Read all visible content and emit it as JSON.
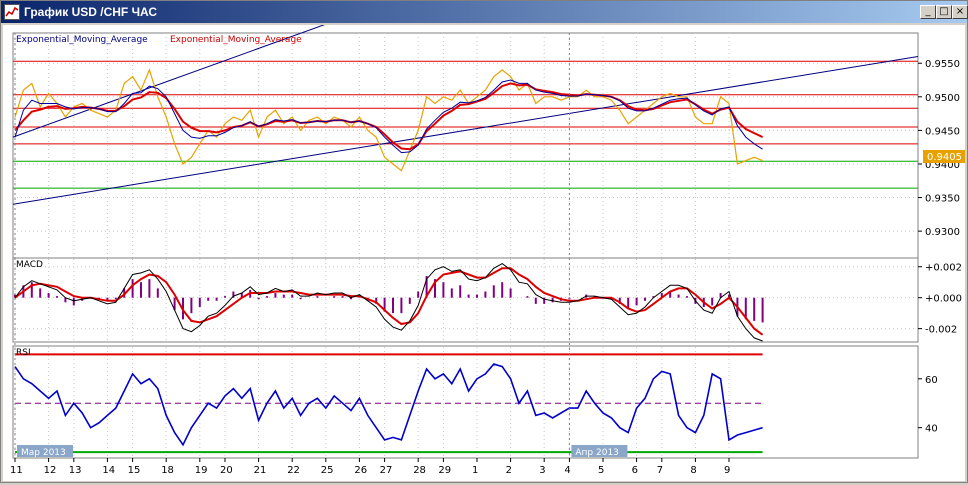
{
  "window": {
    "title": "График USD /CHF ЧАС",
    "buttons": {
      "minimize": "_",
      "maximize": "□",
      "close": "×"
    }
  },
  "chart_data": [
    {
      "type": "line",
      "name": "price",
      "legend": [
        "Exponential_Moving_Average",
        "Exponential_Moving_Average"
      ],
      "ylim": [
        0.926,
        0.9595
      ],
      "yticks": [
        "0.9550",
        "0.9500",
        "0.9450",
        "0.9400",
        "0.9350",
        "0.9300"
      ],
      "current_price": "0.9405",
      "series": [
        {
          "name": "price",
          "color": "#e8a200",
          "values": [
            0.947,
            0.951,
            0.952,
            0.9485,
            0.9505,
            0.949,
            0.947,
            0.9485,
            0.949,
            0.948,
            0.9475,
            0.947,
            0.948,
            0.952,
            0.953,
            0.951,
            0.954,
            0.95,
            0.947,
            0.943,
            0.94,
            0.941,
            0.943,
            0.945,
            0.944,
            0.946,
            0.947,
            0.9465,
            0.948,
            0.944,
            0.947,
            0.948,
            0.946,
            0.947,
            0.945,
            0.9465,
            0.947,
            0.946,
            0.947,
            0.9465,
            0.9455,
            0.947,
            0.945,
            0.944,
            0.941,
            0.94,
            0.939,
            0.942,
            0.945,
            0.95,
            0.949,
            0.95,
            0.9495,
            0.951,
            0.949,
            0.95,
            0.951,
            0.953,
            0.954,
            0.953,
            0.951,
            0.952,
            0.949,
            0.95,
            0.95,
            0.9495,
            0.95,
            0.95,
            0.951,
            0.95,
            0.95,
            0.9495,
            0.948,
            0.946,
            0.947,
            0.948,
            0.949,
            0.95,
            0.9505,
            0.95,
            0.95,
            0.947,
            0.946,
            0.946,
            0.95,
            0.949,
            0.94,
            0.9405,
            0.941,
            0.9405
          ]
        },
        {
          "name": "ema_fast",
          "color": "#0000a0",
          "values": [
            0.944,
            0.948,
            0.9495,
            0.949,
            0.949,
            0.949,
            0.9485,
            0.9482,
            0.9484,
            0.9484,
            0.9482,
            0.9478,
            0.9478,
            0.949,
            0.9505,
            0.9506,
            0.9516,
            0.9512,
            0.95,
            0.9475,
            0.945,
            0.944,
            0.9438,
            0.9442,
            0.9442,
            0.9447,
            0.9454,
            0.9457,
            0.9463,
            0.9456,
            0.946,
            0.9466,
            0.9464,
            0.9466,
            0.9461,
            0.9462,
            0.9464,
            0.9463,
            0.9465,
            0.9465,
            0.9462,
            0.9464,
            0.946,
            0.9454,
            0.944,
            0.9428,
            0.9417,
            0.9418,
            0.9428,
            0.9452,
            0.9465,
            0.9477,
            0.9483,
            0.9492,
            0.9491,
            0.9494,
            0.9499,
            0.951,
            0.9522,
            0.9525,
            0.952,
            0.952,
            0.951,
            0.9507,
            0.9505,
            0.9502,
            0.9501,
            0.9501,
            0.9504,
            0.9503,
            0.9502,
            0.95,
            0.9494,
            0.9483,
            0.9479,
            0.9479,
            0.9483,
            0.9489,
            0.9495,
            0.9497,
            0.9498,
            0.9488,
            0.9479,
            0.9473,
            0.9482,
            0.9485,
            0.9457,
            0.944,
            0.943,
            0.9422
          ]
        },
        {
          "name": "ema_slow",
          "color": "#dd0000",
          "values": [
            0.945,
            0.9465,
            0.9478,
            0.9481,
            0.9485,
            0.9486,
            0.9482,
            0.9483,
            0.9485,
            0.9484,
            0.9482,
            0.9479,
            0.9479,
            0.9486,
            0.9496,
            0.9499,
            0.9507,
            0.9506,
            0.9498,
            0.9482,
            0.9463,
            0.9454,
            0.9449,
            0.9449,
            0.9447,
            0.945,
            0.9455,
            0.9457,
            0.9462,
            0.9456,
            0.9459,
            0.9464,
            0.9463,
            0.9465,
            0.9461,
            0.9462,
            0.9464,
            0.9463,
            0.9465,
            0.9465,
            0.9462,
            0.9464,
            0.946,
            0.9455,
            0.9444,
            0.9432,
            0.9423,
            0.9422,
            0.9429,
            0.9449,
            0.946,
            0.9472,
            0.9479,
            0.9488,
            0.9489,
            0.9493,
            0.9497,
            0.9506,
            0.9516,
            0.952,
            0.9517,
            0.9518,
            0.9511,
            0.9509,
            0.9507,
            0.9504,
            0.9503,
            0.9502,
            0.9504,
            0.9503,
            0.9502,
            0.95,
            0.9495,
            0.9486,
            0.9481,
            0.948,
            0.9482,
            0.9487,
            0.9492,
            0.9494,
            0.9496,
            0.9489,
            0.9481,
            0.9475,
            0.9481,
            0.9484,
            0.9463,
            0.9452,
            0.9446,
            0.944
          ]
        }
      ],
      "hlines": [
        {
          "value": 0.9553,
          "color": "#dd0000"
        },
        {
          "value": 0.9503,
          "color": "#dd0000"
        },
        {
          "value": 0.9483,
          "color": "#dd0000"
        },
        {
          "value": 0.9455,
          "color": "#dd0000"
        },
        {
          "value": 0.943,
          "color": "#dd0000"
        },
        {
          "value": 0.9404,
          "color": "#00aa00"
        },
        {
          "value": 0.9364,
          "color": "#00aa00"
        }
      ],
      "trendlines": [
        {
          "from": [
            0,
            0.934
          ],
          "to": [
            1,
            0.956
          ],
          "color": "#000080"
        },
        {
          "from": [
            0,
            0.944
          ],
          "to": [
            0.37,
            0.962
          ],
          "color": "#000080"
        }
      ]
    },
    {
      "type": "bar",
      "name": "MACD",
      "label": "MACD",
      "ylim": [
        -0.0028,
        0.0025
      ],
      "yticks": [
        "+0.002",
        "+0.000",
        "-0.002"
      ],
      "hist": [
        0.0002,
        0.0008,
        0.001,
        0.0006,
        0.0003,
        0.0001,
        -0.0003,
        -0.0005,
        -0.0002,
        0.0,
        -0.0001,
        -0.0002,
        -0.0001,
        0.0006,
        0.0012,
        0.001,
        0.0012,
        0.0006,
        0.0,
        -0.0008,
        -0.0014,
        -0.001,
        -0.0006,
        -0.0002,
        -0.0002,
        0.0001,
        0.0004,
        0.0003,
        0.0005,
        -0.0001,
        0.0001,
        0.0003,
        0.0002,
        0.0002,
        -0.0001,
        0.0,
        0.0001,
        0.0,
        0.0001,
        0.0001,
        -0.0001,
        0.0001,
        -0.0002,
        -0.0004,
        -0.0009,
        -0.001,
        -0.001,
        -0.0004,
        0.0004,
        0.0014,
        0.0012,
        0.001,
        0.0006,
        0.0008,
        0.0002,
        0.0002,
        0.0004,
        0.0008,
        0.001,
        0.0006,
        0.0,
        0.0001,
        -0.0004,
        -0.0004,
        -0.0003,
        -0.0002,
        -0.0001,
        0.0,
        0.0002,
        0.0001,
        0.0,
        -0.0001,
        -0.0004,
        -0.0007,
        -0.0005,
        -0.0002,
        0.0001,
        0.0003,
        0.0004,
        0.0002,
        0.0001,
        -0.0004,
        -0.0006,
        -0.0005,
        0.0003,
        0.0002,
        -0.0012,
        -0.0014,
        -0.0015,
        -0.0016
      ],
      "macd": [
        0.0,
        0.0007,
        0.0011,
        0.0009,
        0.0007,
        0.0005,
        0.0,
        -0.0002,
        -0.0001,
        0.0,
        -0.0002,
        -0.0004,
        -0.0003,
        0.0006,
        0.0015,
        0.0016,
        0.0018,
        0.0012,
        0.0004,
        -0.0008,
        -0.002,
        -0.0022,
        -0.0018,
        -0.0012,
        -0.001,
        -0.0005,
        0.0001,
        0.0003,
        0.0007,
        0.0002,
        0.0003,
        0.0006,
        0.0004,
        0.0005,
        0.0001,
        0.0001,
        0.0003,
        0.0002,
        0.0003,
        0.0003,
        0.0,
        0.0002,
        -0.0002,
        -0.0006,
        -0.0014,
        -0.0019,
        -0.0021,
        -0.0015,
        -0.0005,
        0.0012,
        0.0018,
        0.002,
        0.0017,
        0.0018,
        0.0012,
        0.0011,
        0.0013,
        0.0019,
        0.0022,
        0.0018,
        0.001,
        0.0009,
        0.0002,
        -0.0001,
        -0.0002,
        -0.0003,
        -0.0003,
        -0.0002,
        0.0001,
        0.0001,
        0.0,
        -0.0001,
        -0.0006,
        -0.0011,
        -0.001,
        -0.0006,
        0.0,
        0.0004,
        0.0008,
        0.0008,
        0.0006,
        -0.0002,
        -0.0008,
        -0.001,
        0.0,
        0.0004,
        -0.0012,
        -0.002,
        -0.0026,
        -0.0028
      ],
      "signal": [
        0.0,
        0.0004,
        0.0008,
        0.0009,
        0.0008,
        0.0007,
        0.0004,
        0.0001,
        0.0,
        0.0,
        -0.0001,
        -0.0002,
        -0.0002,
        0.0002,
        0.0008,
        0.0012,
        0.0015,
        0.0014,
        0.001,
        0.0002,
        -0.0008,
        -0.0015,
        -0.0016,
        -0.0014,
        -0.0012,
        -0.0008,
        -0.0004,
        0.0,
        0.0003,
        0.0003,
        0.0003,
        0.0004,
        0.0004,
        0.0004,
        0.0003,
        0.0002,
        0.0002,
        0.0002,
        0.0002,
        0.0002,
        0.0001,
        0.0001,
        -0.0001,
        -0.0003,
        -0.0008,
        -0.0013,
        -0.0017,
        -0.0016,
        -0.001,
        0.0001,
        0.001,
        0.0015,
        0.0016,
        0.0017,
        0.0015,
        0.0013,
        0.0013,
        0.0016,
        0.0019,
        0.0019,
        0.0015,
        0.0012,
        0.0007,
        0.0003,
        0.0001,
        -0.0001,
        -0.0002,
        -0.0002,
        -0.0001,
        0.0,
        0.0,
        0.0,
        -0.0003,
        -0.0007,
        -0.0009,
        -0.0008,
        -0.0004,
        0.0,
        0.0004,
        0.0006,
        0.0006,
        0.0002,
        -0.0003,
        -0.0007,
        -0.0004,
        0.0,
        -0.0006,
        -0.0013,
        -0.002,
        -0.0024
      ]
    },
    {
      "type": "line",
      "name": "RSI",
      "label": "RSI",
      "ylim": [
        28,
        73
      ],
      "yticks": [
        "60",
        "40"
      ],
      "levels": [
        {
          "value": 70,
          "color": "#dd0000"
        },
        {
          "value": 50,
          "color": "#800080"
        },
        {
          "value": 30,
          "color": "#00aa00"
        }
      ],
      "values": [
        65,
        60,
        58,
        55,
        52,
        55,
        45,
        50,
        46,
        40,
        42,
        45,
        48,
        55,
        62,
        58,
        60,
        56,
        45,
        38,
        33,
        40,
        45,
        50,
        48,
        53,
        56,
        52,
        56,
        43,
        50,
        55,
        48,
        52,
        45,
        50,
        52,
        48,
        53,
        50,
        47,
        52,
        45,
        40,
        35,
        36,
        35,
        45,
        55,
        64,
        60,
        62,
        58,
        64,
        55,
        60,
        62,
        66,
        65,
        60,
        50,
        55,
        45,
        46,
        44,
        46,
        48,
        48,
        55,
        50,
        46,
        44,
        40,
        38,
        48,
        52,
        60,
        63,
        62,
        45,
        40,
        38,
        45,
        62,
        60,
        35,
        37,
        38,
        39,
        40
      ],
      "x_markers": [
        {
          "label": "Мар 2013",
          "at": 0
        },
        {
          "label": "Апр 2013",
          "at": 66
        }
      ]
    }
  ],
  "x_axis": {
    "labels": [
      "11",
      "12",
      "13",
      "14",
      "15",
      "18",
      "19",
      "20",
      "21",
      "22",
      "25",
      "26",
      "27",
      "28",
      "29",
      "1",
      "2",
      "3",
      "4",
      "5",
      "6",
      "7",
      "8",
      "9"
    ],
    "positions": [
      0,
      4,
      7,
      11,
      14,
      18,
      22,
      25,
      29,
      33,
      37,
      41,
      44,
      48,
      51,
      55,
      59,
      63,
      66,
      70,
      74,
      77,
      81,
      85
    ]
  }
}
